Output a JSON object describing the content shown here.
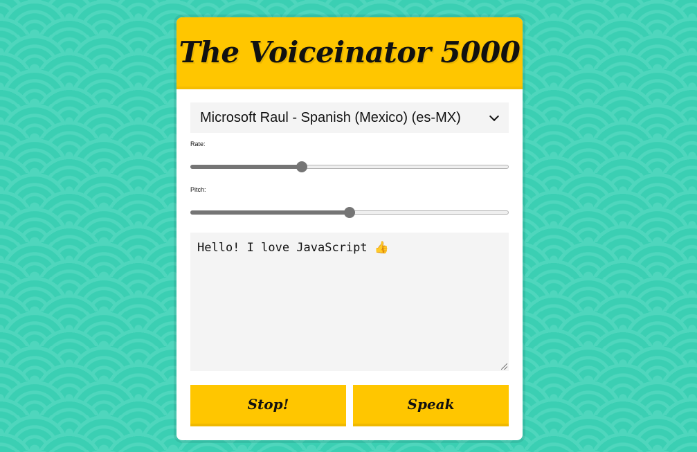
{
  "app": {
    "title": "The Voiceinator 5000"
  },
  "voice_select": {
    "selected": "Microsoft Raul - Spanish (Mexico) (es-MX)"
  },
  "rate": {
    "label": "Rate:",
    "value_fraction": 0.345
  },
  "pitch": {
    "label": "Pitch:",
    "value_fraction": 0.5
  },
  "message": {
    "text": "Hello! I love JavaScript",
    "emoji": "👍"
  },
  "buttons": {
    "stop": "Stop!",
    "speak": "Speak"
  },
  "colors": {
    "accent": "#ffc600",
    "background": "#3bcfb3"
  },
  "icons": {
    "select_arrow": "chevron-down-icon",
    "resize": "resize-grip-icon"
  }
}
